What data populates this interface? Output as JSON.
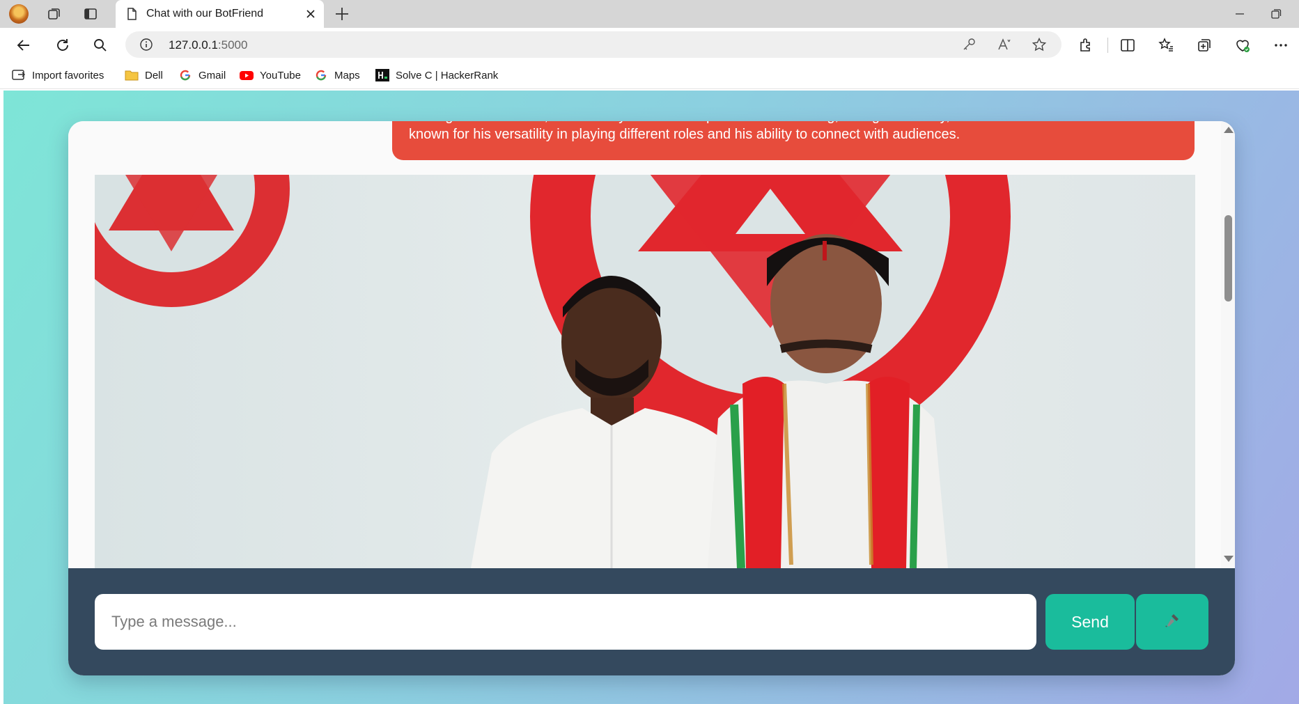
{
  "browser": {
    "tab_title": "Chat with our BotFriend",
    "url_host": "127.0.0.1",
    "url_port": ":5000"
  },
  "favorites": [
    {
      "label": "Import favorites",
      "icon": "import-icon"
    },
    {
      "label": "Dell",
      "icon": "folder-icon"
    },
    {
      "label": "Gmail",
      "icon": "google-icon"
    },
    {
      "label": "YouTube",
      "icon": "youtube-icon"
    },
    {
      "label": "Maps",
      "icon": "google-icon"
    },
    {
      "label": "Solve C | HackerRank",
      "icon": "hackerrank-icon"
    }
  ],
  "chat": {
    "bot_message": "Throughout his career, Pawan Kalyan has been praised for his acting, dialogue delivery, and distinct dance moves. He is known for his versatility in playing different roles and his ability to connect with audiences.",
    "input_placeholder": "Type a message...",
    "send_label": "Send"
  },
  "colors": {
    "bot_bubble": "#e74c3c",
    "composer": "#34495e",
    "accent": "#1abc9c"
  }
}
